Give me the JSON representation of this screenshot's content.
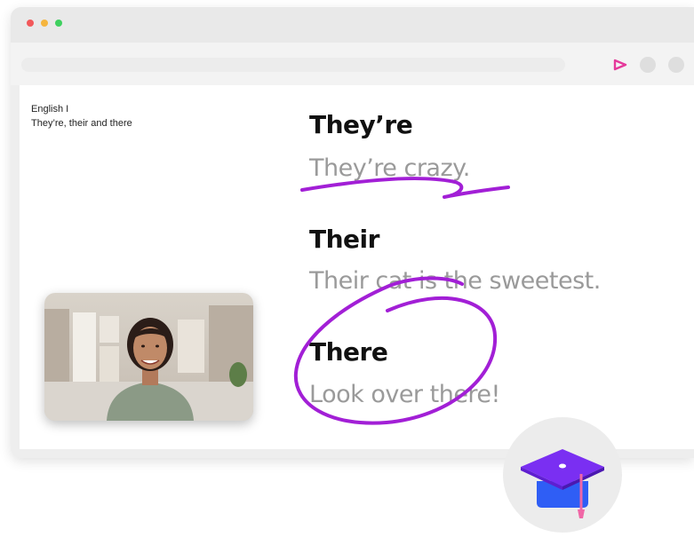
{
  "window": {
    "controls": [
      "close",
      "minimize",
      "maximize"
    ]
  },
  "toolbar": {
    "share_icon": "share-arrow-icon",
    "accent_color": "#e5399a"
  },
  "lesson": {
    "course": "English I",
    "title": "They’re, their and there"
  },
  "words": [
    {
      "heading": "They’re",
      "example": "They’re crazy."
    },
    {
      "heading": "Their",
      "example": "Their cat is the sweetest."
    },
    {
      "heading": "There",
      "example": "Look over there!"
    }
  ],
  "colors": {
    "annotation": "#a21fd6",
    "heading_text": "#111111",
    "example_text": "#9a9a9a",
    "cap_top": "#7a2ff2",
    "cap_band": "#2f5ef5",
    "tassel": "#f067a6"
  },
  "badge": {
    "icon": "graduation-cap-icon"
  }
}
